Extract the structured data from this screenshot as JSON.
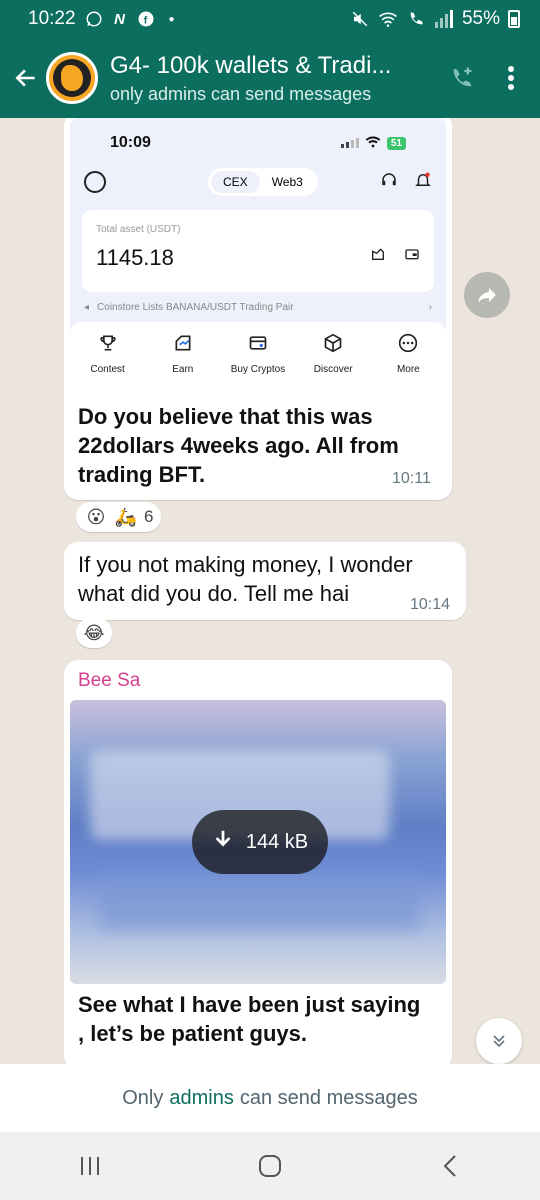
{
  "status_bar": {
    "time": "10:22",
    "battery": "55%"
  },
  "header": {
    "title": "G4- 100k wallets & Tradi...",
    "subtitle": "only admins can send messages"
  },
  "messages": {
    "shot": {
      "phone_time": "10:09",
      "phone_battery": "51",
      "tab_cex": "CEX",
      "tab_web3": "Web3",
      "asset_label": "Total asset (USDT)",
      "asset_value": "1145.18",
      "ticker": "Coinstore Lists BANANA/USDT Trading Pair",
      "menu": [
        "Contest",
        "Earn",
        "Buy Cryptos",
        "Discover",
        "More"
      ],
      "caption": "Do you believe that this was 22dollars 4weeks ago. All from trading BFT.",
      "time": "10:11",
      "reaction_count": "6"
    },
    "text": {
      "body": "If you not making money, I wonder what did you do. Tell me hai",
      "time": "10:14"
    },
    "image": {
      "sender": "Bee Sa",
      "download_size": "144 kB",
      "caption": "See what I have been just saying , let’s be patient guys."
    }
  },
  "footer": {
    "notice_prefix": "Only",
    "notice_link": "admins",
    "notice_suffix": "can send messages"
  },
  "colors": {
    "header": "#0b6e5f",
    "sender": "#d63f8f",
    "chat_bg": "#ece5dd"
  },
  "icons": [
    "whatsapp-icon",
    "netflix-icon",
    "facebook-icon",
    "mute-icon",
    "wifi-icon",
    "call-icon",
    "signal-icon",
    "battery-icon",
    "back-arrow-icon",
    "add-call-icon",
    "more-vert-icon",
    "forward-icon",
    "download-icon",
    "scroll-down-icon",
    "recents-icon",
    "home-icon",
    "back-nav-icon"
  ]
}
